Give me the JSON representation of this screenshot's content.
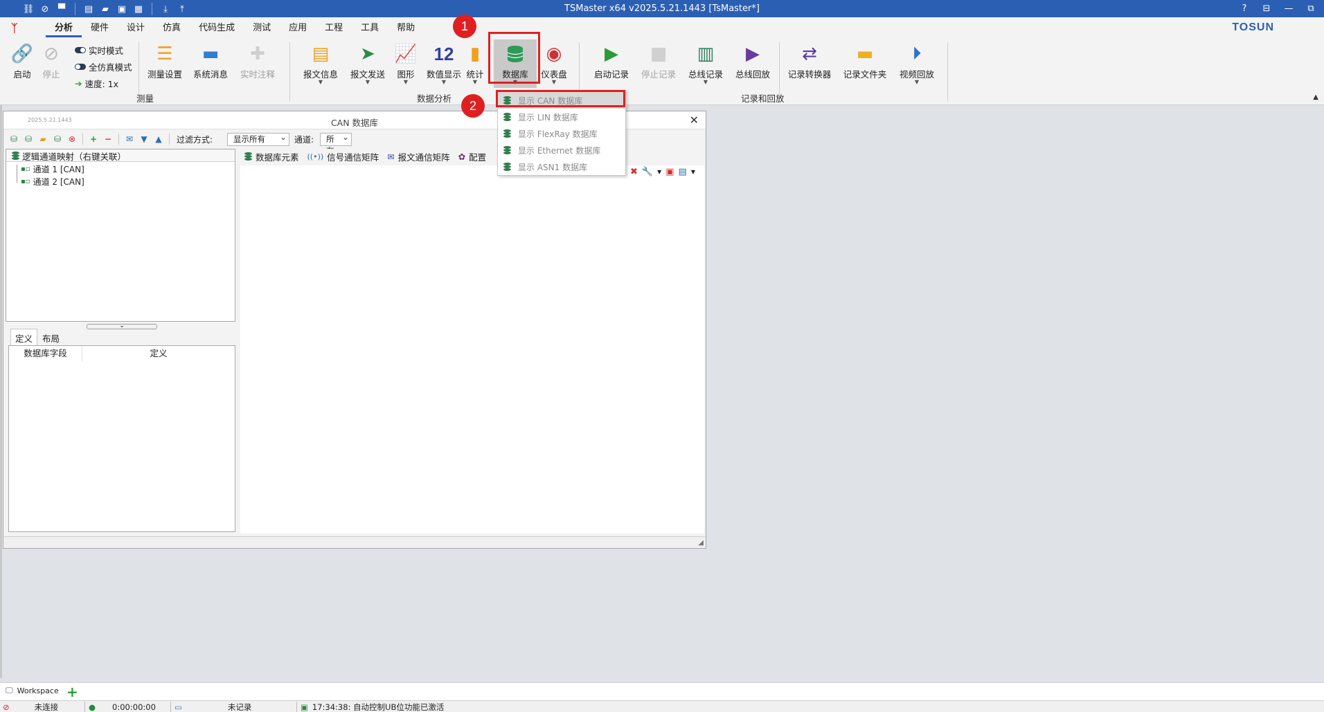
{
  "window": {
    "title": "TSMaster x64 v2025.5.21.1443 [TsMaster*]",
    "controls": [
      "?",
      "⊟",
      "—",
      "⧉"
    ]
  },
  "menu": {
    "tabs": [
      "分析",
      "硬件",
      "设计",
      "仿真",
      "代码生成",
      "测试",
      "应用",
      "工程",
      "工具",
      "帮助"
    ],
    "active": "分析",
    "brand": "TOSUN"
  },
  "ribbon": {
    "measure": {
      "start": "启动",
      "stop": "停止",
      "realtime_mode": "实时模式",
      "full_sim_mode": "全仿真模式",
      "speed": "速度: 1x",
      "settings": "测量设置",
      "sys_msg": "系统消息",
      "rt_note": "实时注释",
      "group": "测量"
    },
    "analysis": {
      "msg_info": "报文信息",
      "msg_send": "报文发送",
      "graph": "图形",
      "value_display": "数值显示",
      "value_glyph": "12",
      "stats": "统计",
      "database": "数据库",
      "dashboard": "仪表盘",
      "group": "数据分析"
    },
    "record": {
      "start_rec": "启动记录",
      "stop_rec": "停止记录",
      "bus_rec": "总线记录",
      "bus_replay": "总线回放",
      "converter": "记录转换器",
      "folder": "记录文件夹",
      "video": "视频回放",
      "group": "记录和回放"
    },
    "badges": {
      "one": "1",
      "two": "2"
    }
  },
  "db_window": {
    "version": "2025.5.21.1443",
    "title": "CAN 数据库",
    "filter_label": "过滤方式:",
    "filter_value": "显示所有",
    "channel_label": "通道:",
    "channel_value": "所有",
    "tree_header": "逻辑通道映射（右键关联）",
    "tree_items": [
      "通道 1 [CAN]",
      "通道 2 [CAN]"
    ],
    "def_tabs": [
      "定义",
      "布局"
    ],
    "def_columns": [
      "数据库字段",
      "定义"
    ],
    "right_tabs": [
      "数据库元素",
      "信号通信矩阵",
      "报文通信矩阵",
      "配置"
    ]
  },
  "dropdown": {
    "items": [
      "显示 CAN 数据库",
      "显示 LIN 数据库",
      "显示 FlexRay 数据库",
      "显示 Ethernet 数据库",
      "显示 ASN1 数据库"
    ],
    "highlighted_index": 0
  },
  "workspace": {
    "tab": "Workspace"
  },
  "status": {
    "connection": "未连接",
    "time": "0:00:00:00",
    "record": "未记录",
    "message": "17:34:38: 自动控制UB位功能已激活"
  },
  "colors": {
    "titlebar": "#2b5fb3",
    "accent_red": "#e02020",
    "db_green": "#2e7d4a"
  }
}
